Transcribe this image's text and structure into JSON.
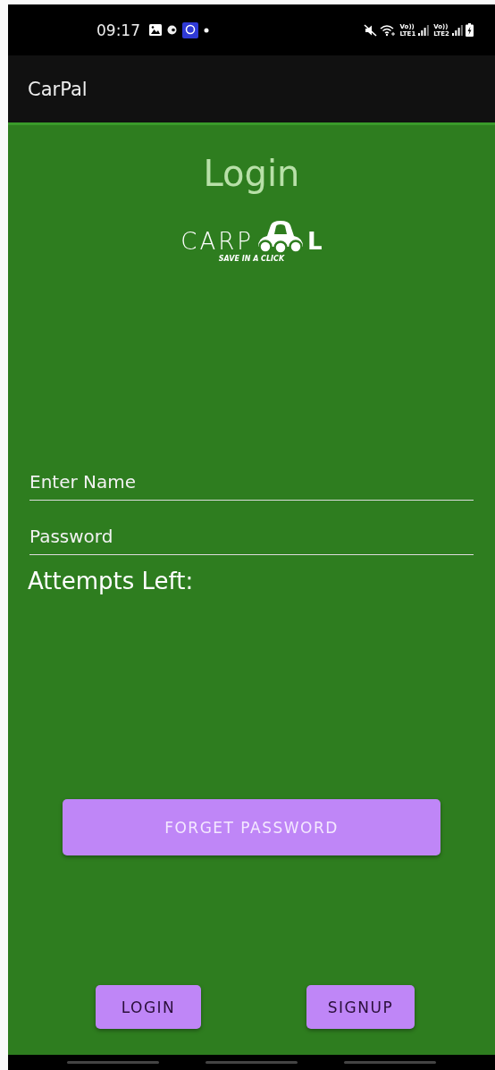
{
  "status_bar": {
    "time": "09:17",
    "sims": [
      {
        "volte": "Vo))",
        "network": "LTE1"
      },
      {
        "volte": "Vo))",
        "network": "LTE2"
      }
    ]
  },
  "app_bar": {
    "title": "CarPal"
  },
  "heading": "Login",
  "logo": {
    "left": "CARP",
    "right": "L",
    "tagline": "SAVE IN A CLICK"
  },
  "fields": [
    {
      "placeholder": "Enter Name"
    },
    {
      "placeholder": "Password"
    }
  ],
  "attempts_label": "Attempts Left:",
  "forget_button": "FORGET PASSWORD",
  "buttons": [
    "LOGIN",
    "SIGNUP"
  ]
}
